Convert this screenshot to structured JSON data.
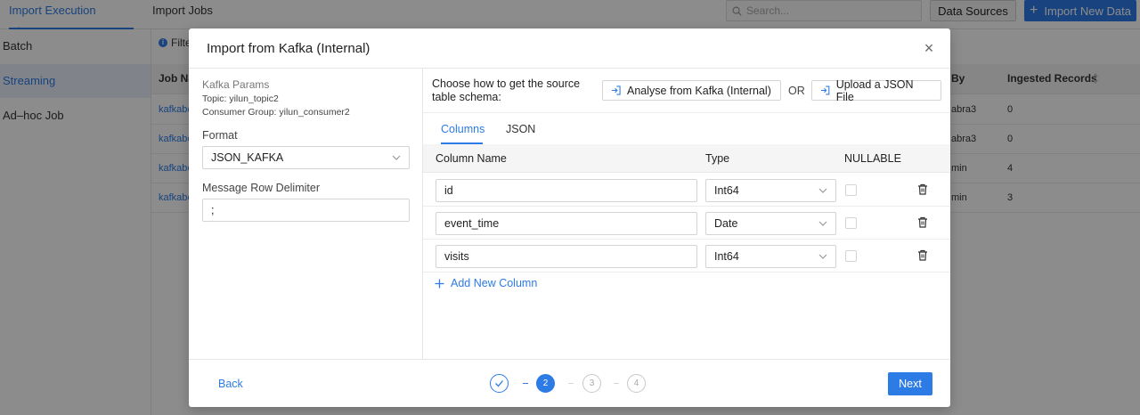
{
  "topbar": {
    "tabs": [
      "Import Execution History",
      "Import Jobs"
    ],
    "search_placeholder": "Search...",
    "data_sources_label": "Data Sources",
    "import_new_label": "Import New Data"
  },
  "sidebar": {
    "items": [
      "Batch",
      "Streaming",
      "Ad–hoc Job"
    ]
  },
  "content": {
    "filter_label": "Filte",
    "columns": [
      "Job Na",
      "By",
      "Ingested Records"
    ],
    "rows": [
      {
        "name": "kafkabc",
        "by": "abra3",
        "records": "0"
      },
      {
        "name": "kafkabc",
        "by": "abra3",
        "records": "0"
      },
      {
        "name": "kafkabc",
        "by": "min",
        "records": "4"
      },
      {
        "name": "kafkabc",
        "by": "min",
        "records": "3"
      }
    ]
  },
  "modal": {
    "title": "Import from Kafka (Internal)",
    "close_icon": "×",
    "left": {
      "params_title": "Kafka Params",
      "topic_line": "Topic: yilun_topic2",
      "group_line": "Consumer Group: yilun_consumer2",
      "format_label": "Format",
      "format_value": "JSON_KAFKA",
      "delimiter_label": "Message Row Delimiter",
      "delimiter_value": ";"
    },
    "right": {
      "choose_text": "Choose how to get the source table schema:",
      "analyse_label": "Analyse from Kafka (Internal)",
      "or_label": "OR",
      "upload_label": "Upload a JSON File",
      "tabs": [
        "Columns",
        "JSON"
      ],
      "headers": {
        "name": "Column Name",
        "type": "Type",
        "nullable": "NULLABLE"
      },
      "columns": [
        {
          "name": "id",
          "type": "Int64"
        },
        {
          "name": "event_time",
          "type": "Date"
        },
        {
          "name": "visits",
          "type": "Int64"
        }
      ],
      "add_label": "Add New Column"
    },
    "footer": {
      "back_label": "Back",
      "steps": [
        "",
        "2",
        "3",
        "4"
      ],
      "next_label": "Next"
    }
  },
  "colors": {
    "accent": "#2d7be5",
    "overlay": "rgba(0,0,0,0.45)"
  }
}
